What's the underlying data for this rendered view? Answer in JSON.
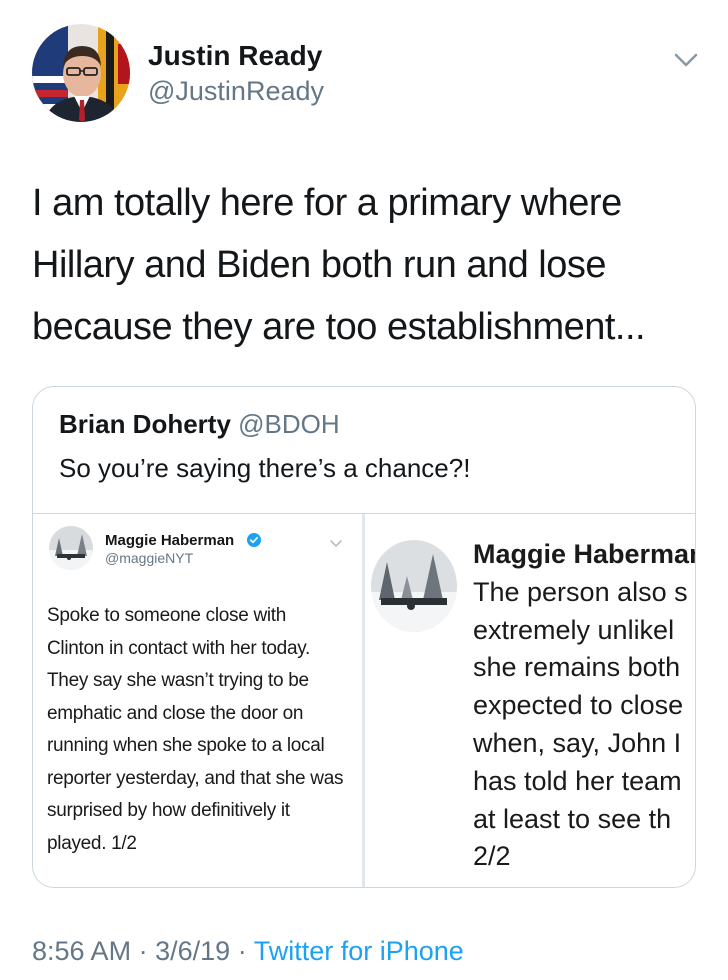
{
  "author": {
    "name": "Justin Ready",
    "handle": "@JustinReady"
  },
  "tweet": {
    "text": "I am totally here for a primary where Hillary and Biden both run and lose because they are too establishment..."
  },
  "quoted_tweet": {
    "name": "Brian Doherty",
    "handle": "@BDOH",
    "text": "So you’re saying there’s a chance?!",
    "screenshot_1": {
      "name": "Maggie Haberman",
      "handle": "@maggieNYT",
      "verified": true,
      "text": "Spoke to someone close with Clinton in contact with her today. They say she wasn’t trying to be emphatic and close the door on running when she spoke to a local reporter yesterday, and that she was surprised by how definitively it played. 1/2"
    },
    "screenshot_2": {
      "name": "Maggie Haberman",
      "lines": [
        "The person also s",
        "extremely unlikel",
        "she remains both",
        "expected to close",
        "when, say, John I",
        "has told her team",
        "at least to see th",
        "2/2"
      ]
    }
  },
  "meta": {
    "time": "8:56 AM",
    "date": "3/6/19",
    "source": "Twitter for iPhone",
    "separator": "·"
  },
  "colors": {
    "link_blue": "#1da1f2",
    "secondary_text": "#657786",
    "border": "#ccd6dd",
    "verified_blue": "#1da1f2"
  },
  "icons": {
    "caret": "chevron-down-icon",
    "verified": "verified-badge-icon"
  }
}
